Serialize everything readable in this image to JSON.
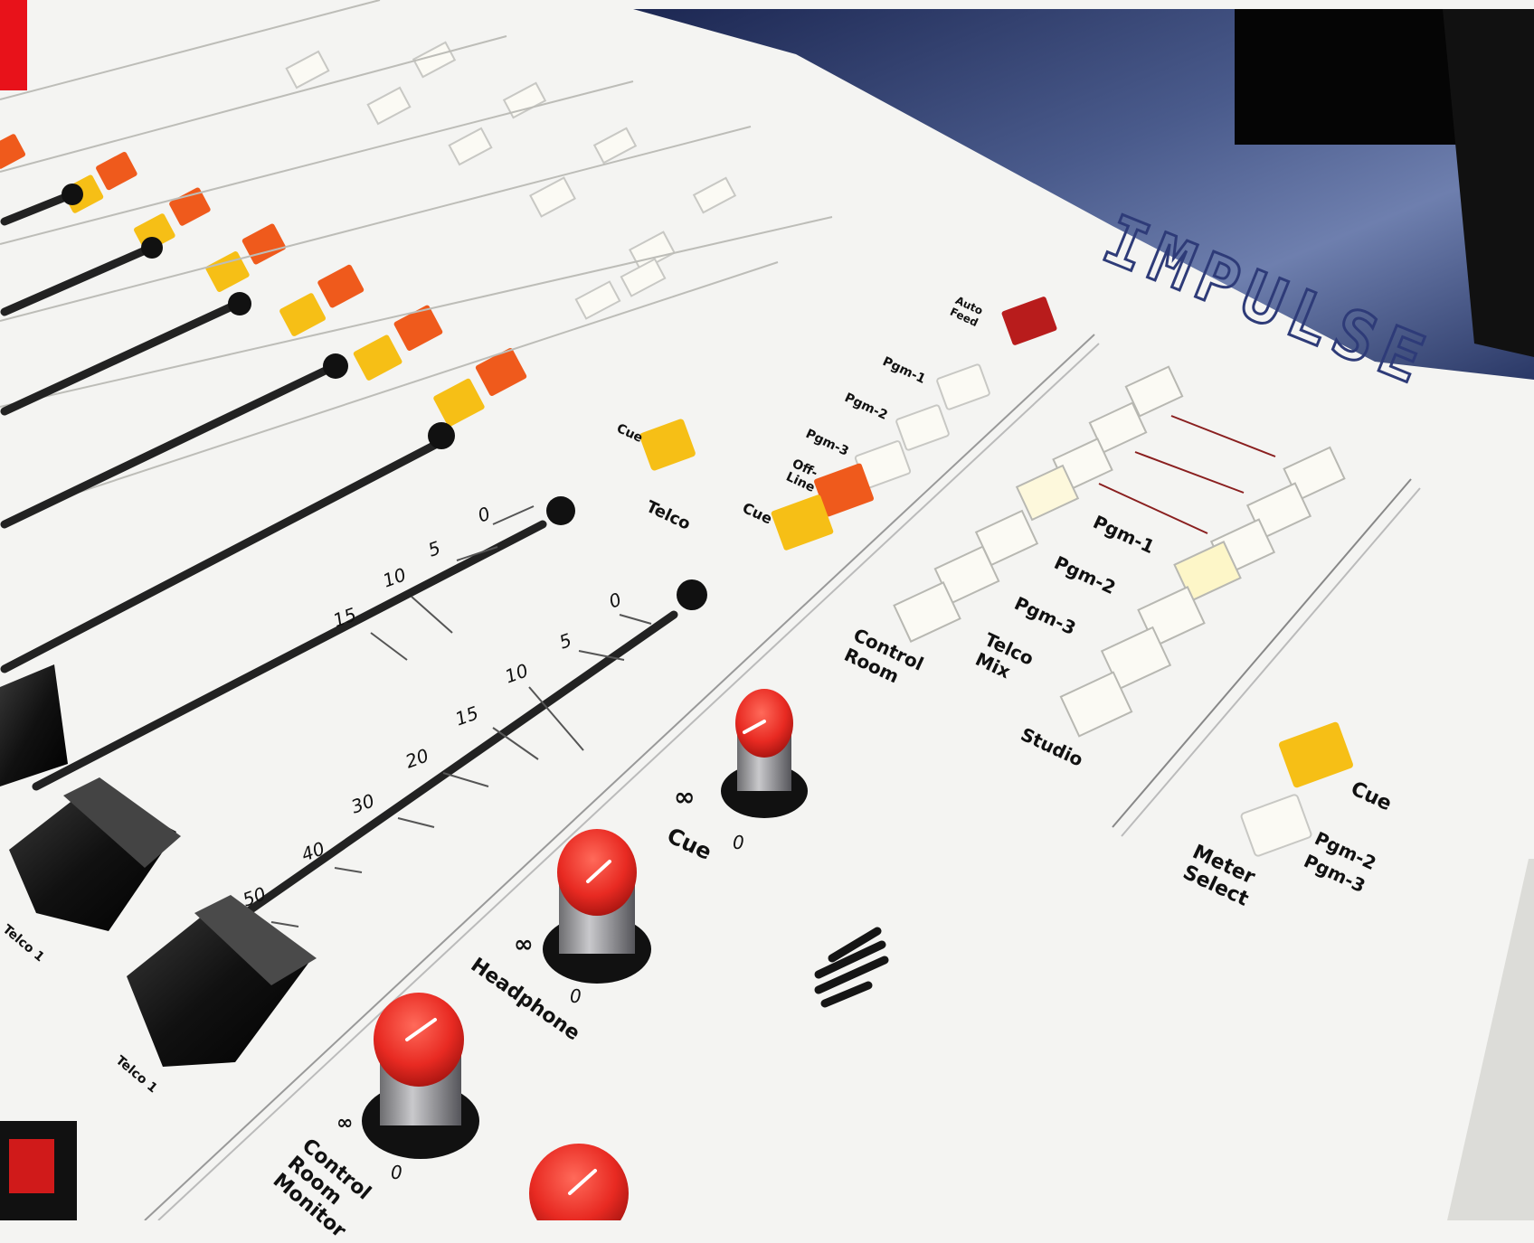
{
  "brand": {
    "logo_text": "IMPULSE"
  },
  "colors": {
    "panel": "#f4f4f2",
    "cover": "#2c3a66",
    "screen": "#0a0a0a",
    "accent_red": "#e8121a",
    "knob_red": "#e82a22",
    "button_yellow": "#f6bf16",
    "button_orange": "#ef5a1c",
    "button_dark_red": "#b81c1c",
    "button_white": "#fbfaf4",
    "fader_cap": "#151515"
  },
  "fader_scale": [
    "0",
    "5",
    "10",
    "15",
    "20",
    "30",
    "40",
    "50"
  ],
  "channel_buttons": {
    "cue": "Cue",
    "off_line": "Off-Line",
    "pgm": "Pgm"
  },
  "telco_section": {
    "cue": "Cue",
    "name": "Telco",
    "auto_feed": "Auto Feed",
    "pgm1": "Pgm-1",
    "pgm2": "Pgm-2",
    "pgm3": "Pgm-3",
    "off_line": "Off-Line",
    "cue2": "Cue"
  },
  "monitor_section": {
    "pgm1": "Pgm-1",
    "pgm2": "Pgm-2",
    "pgm3": "Pgm-3",
    "control_room": "Control Room",
    "telco_mix": "Telco Mix",
    "studio": "Studio"
  },
  "meter_section": {
    "cue": "Cue",
    "pgm2": "Pgm-2",
    "pgm3": "Pgm-3",
    "meter_select": "Meter Select"
  },
  "knobs": {
    "cue": {
      "label": "Cue",
      "min": "0",
      "max": "∞"
    },
    "headphone": {
      "label": "Headphone",
      "min": "0",
      "max": "∞"
    },
    "control_room": {
      "label": "Control Room Monitor",
      "min": "0",
      "max": "∞"
    }
  },
  "fader_labels": {
    "telco1": "Telco 1",
    "telco2": "Telco 1"
  }
}
